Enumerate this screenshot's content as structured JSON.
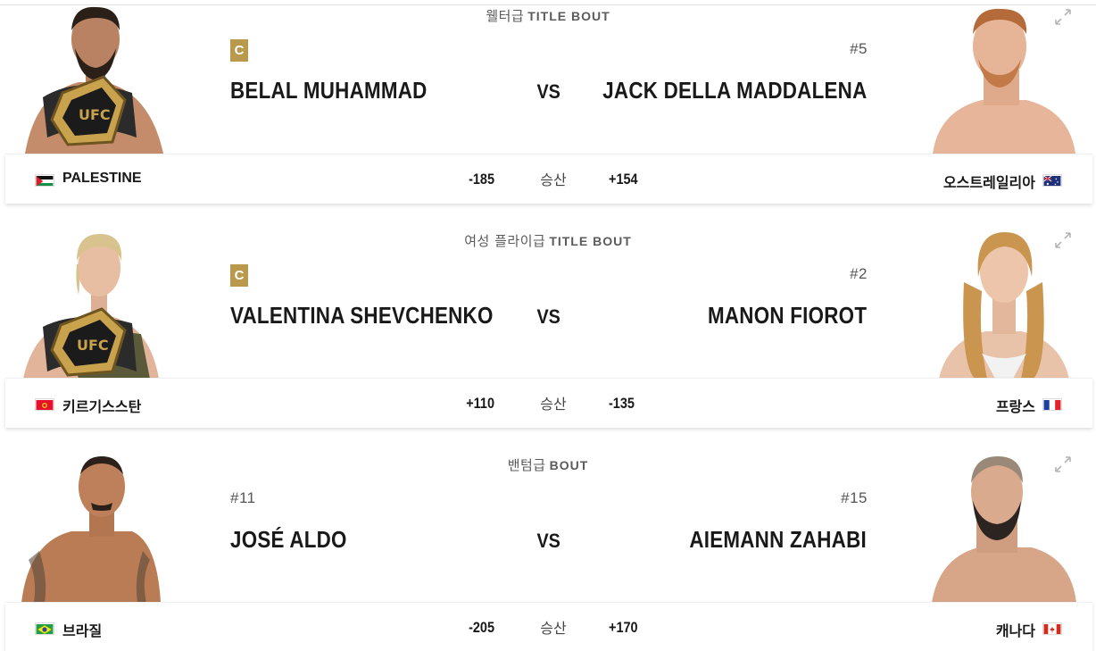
{
  "bouts": [
    {
      "weight_class": "웰터급",
      "bout_type": "TITLE BOUT",
      "left": {
        "name": "BELAL MUHAMMAD",
        "badge": "C",
        "rank": "",
        "country": "PALESTINE",
        "odds": "-185",
        "flag": "palestine-flag"
      },
      "right": {
        "name": "JACK DELLA MADDALENA",
        "badge": "",
        "rank": "#5",
        "country": "오스트레일리아",
        "odds": "+154",
        "flag": "australia-flag"
      },
      "vs": "VS",
      "odds_label": "승산"
    },
    {
      "weight_class": "여성 플라이급",
      "bout_type": "TITLE BOUT",
      "left": {
        "name": "VALENTINA SHEVCHENKO",
        "badge": "C",
        "rank": "",
        "country": "키르기스스탄",
        "odds": "+110",
        "flag": "kyrgyzstan-flag"
      },
      "right": {
        "name": "MANON FIOROT",
        "badge": "",
        "rank": "#2",
        "country": "프랑스",
        "odds": "-135",
        "flag": "france-flag"
      },
      "vs": "VS",
      "odds_label": "승산"
    },
    {
      "weight_class": "밴텀급",
      "bout_type": "BOUT",
      "left": {
        "name": "JOSÉ ALDO",
        "badge": "",
        "rank": "#11",
        "country": "브라질",
        "odds": "-205",
        "flag": "brazil-flag"
      },
      "right": {
        "name": "AIEMANN ZAHABI",
        "badge": "",
        "rank": "#15",
        "country": "캐나다",
        "odds": "+170",
        "flag": "canada-flag"
      },
      "vs": "VS",
      "odds_label": "승산"
    }
  ],
  "colors": {
    "champion_badge": "#b9994c",
    "text": "#191919",
    "muted": "#5b5b5b"
  }
}
